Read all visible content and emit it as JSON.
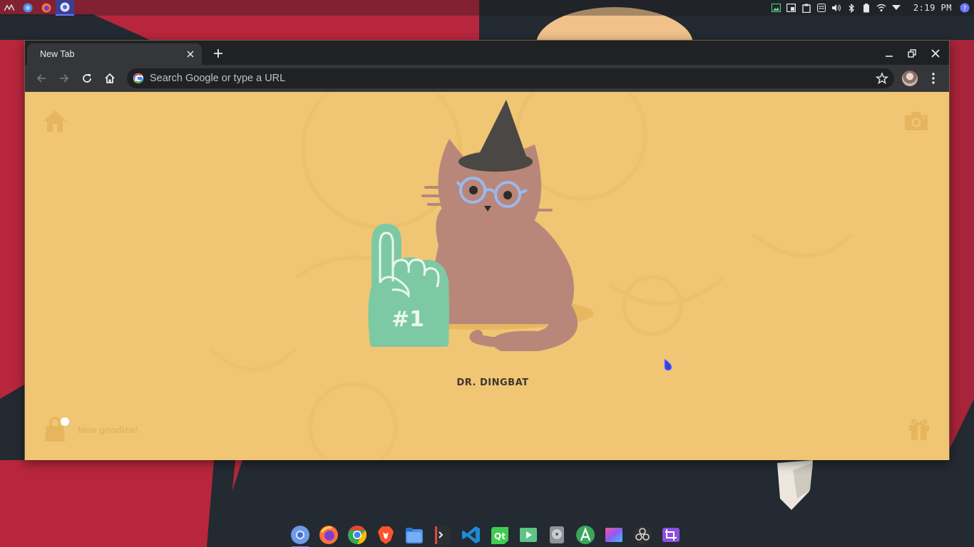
{
  "panel": {
    "clock": "2:19 PM",
    "launchers": [
      "app-menu-icon",
      "web-browser-icon",
      "firefox-icon",
      "chrome-icon"
    ],
    "tray": [
      "image-viewer-icon",
      "window-icon",
      "clipboard-icon",
      "storage-icon",
      "volume-icon",
      "bluetooth-icon",
      "battery-icon",
      "network-icon",
      "dropdown-icon",
      "notification-icon"
    ]
  },
  "browser": {
    "tab_title": "New Tab",
    "omnibox_placeholder": "Search Google or type a URL"
  },
  "newtab": {
    "cat_name": "DR. DINGBAT",
    "foam_finger_text": "#1",
    "goodies_label": "New goodies!"
  },
  "dock": [
    "chromium",
    "firefox",
    "chrome",
    "brave",
    "files",
    "terminal",
    "vscode",
    "qt-creator",
    "media-player",
    "disk-utility",
    "android-studio",
    "image-editor",
    "obs",
    "crop-tool"
  ],
  "colors": {
    "newtab_bg": "#f0c674",
    "cat_fur": "#b8877a",
    "foam_finger": "#7dc9a4",
    "wallpaper_red": "#b8263d",
    "wallpaper_dark": "#232a31",
    "chrome_dark": "#202124",
    "chrome_toolbar": "#35363a",
    "accent": "#6b79ff"
  }
}
